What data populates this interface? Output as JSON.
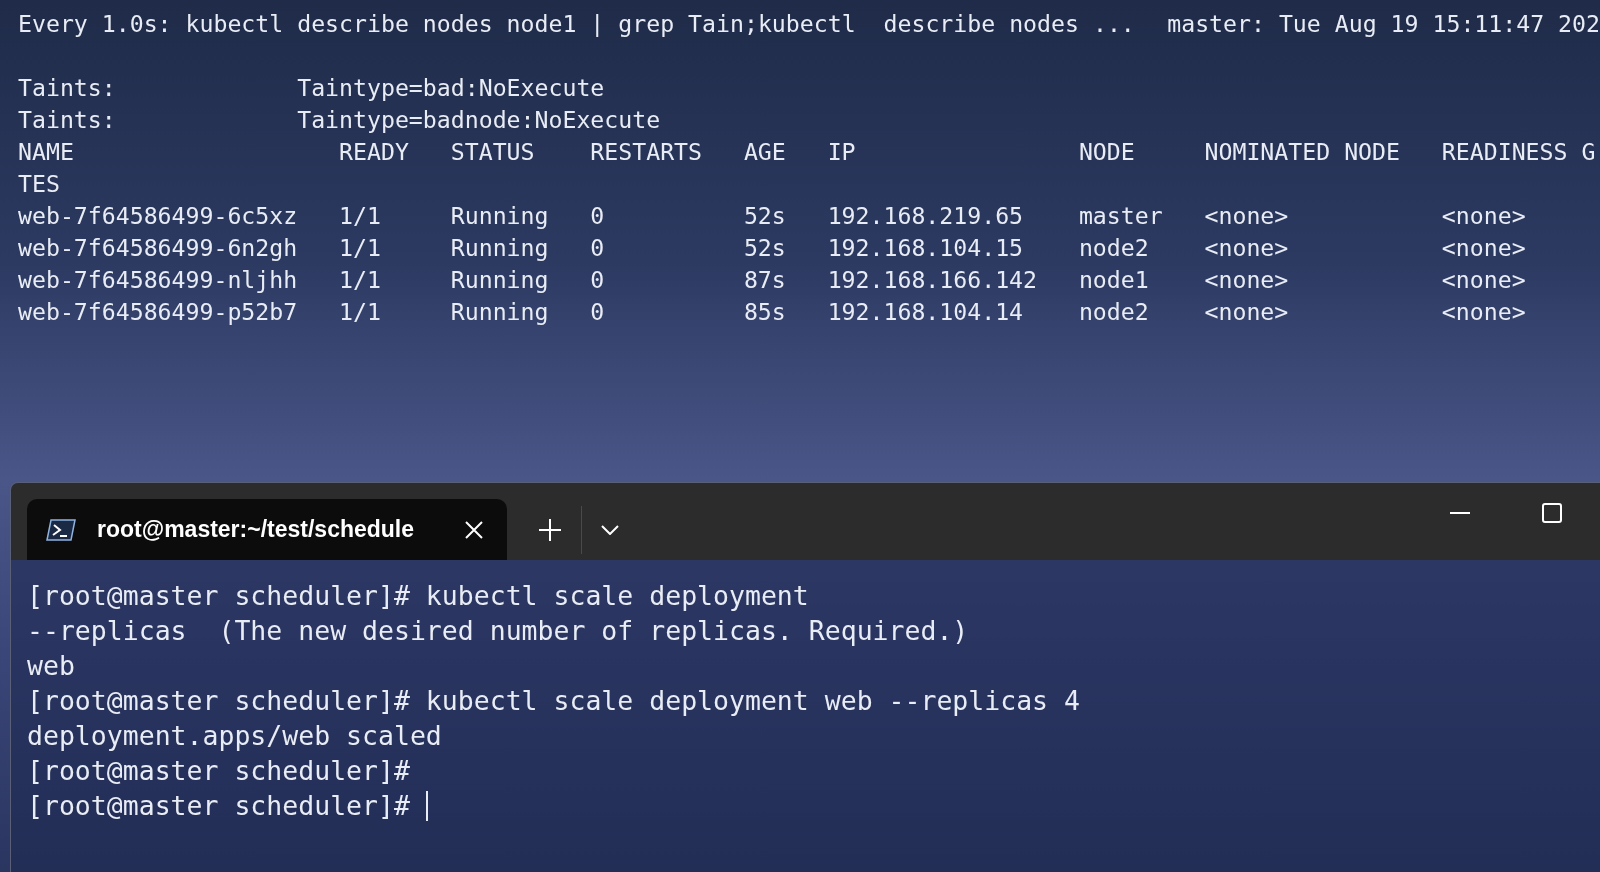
{
  "watch_window": {
    "header_command": "Every 1.0s: kubectl describe nodes node1 | grep Tain;kubectl  describe nodes ...",
    "header_host_time": "master: Tue Aug 19 15:11:47 202",
    "taints": [
      {
        "label": "Taints:",
        "value": "Taintype=bad:NoExecute"
      },
      {
        "label": "Taints:",
        "value": "Taintype=badnode:NoExecute"
      }
    ],
    "pods_table": {
      "columns": [
        "NAME",
        "READY",
        "STATUS",
        "RESTARTS",
        "AGE",
        "IP",
        "NODE",
        "NOMINATED NODE",
        "READINESS G"
      ],
      "header_wrap": "TES",
      "rows": [
        [
          "web-7f64586499-6c5xz",
          "1/1",
          "Running",
          "0",
          "52s",
          "192.168.219.65",
          "master",
          "<none>",
          "<none>"
        ],
        [
          "web-7f64586499-6n2gh",
          "1/1",
          "Running",
          "0",
          "52s",
          "192.168.104.15",
          "node2",
          "<none>",
          "<none>"
        ],
        [
          "web-7f64586499-nljhh",
          "1/1",
          "Running",
          "0",
          "87s",
          "192.168.166.142",
          "node1",
          "<none>",
          "<none>"
        ],
        [
          "web-7f64586499-p52b7",
          "1/1",
          "Running",
          "0",
          "85s",
          "192.168.104.14",
          "node2",
          "<none>",
          "<none>"
        ]
      ]
    }
  },
  "terminal_window": {
    "tabs": [
      {
        "title": "root@master:~/test/schedule",
        "selected": true
      }
    ],
    "lines": [
      "[root@master scheduler]# kubectl scale deployment",
      "--replicas  (The new desired number of replicas. Required.)",
      "web",
      "[root@master scheduler]# kubectl scale deployment web --replicas 4",
      "deployment.apps/web scaled",
      "[root@master scheduler]#",
      "[root@master scheduler]# "
    ],
    "cursor": true
  }
}
